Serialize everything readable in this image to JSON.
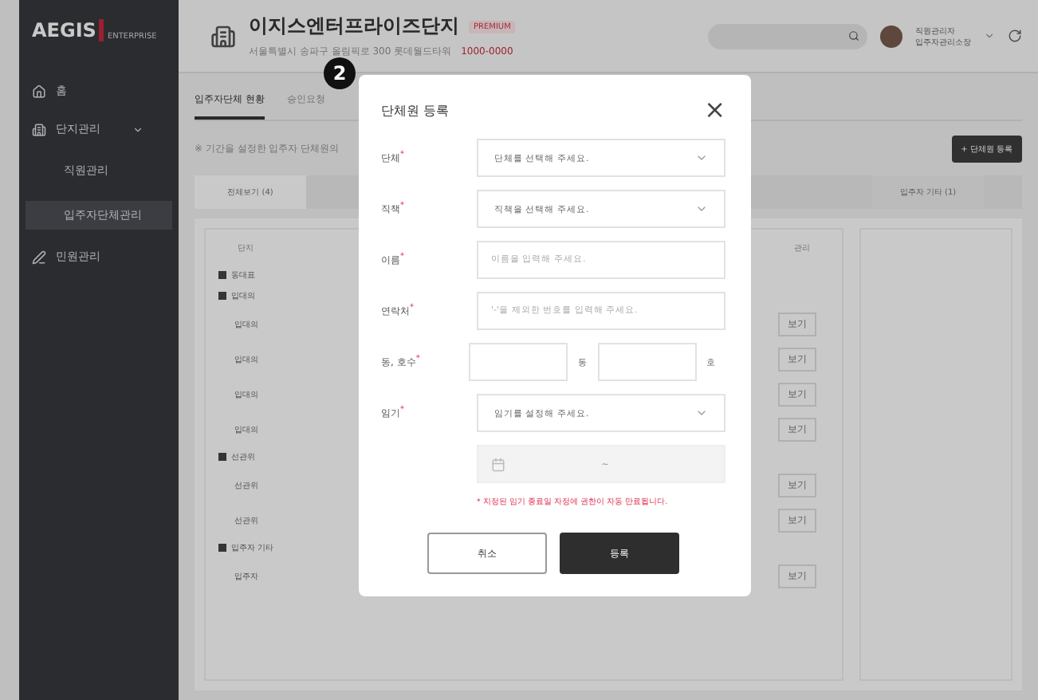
{
  "sidebar": {
    "logo": "AEGIS",
    "logo_sub": "ENTERPRISE",
    "items": [
      {
        "label": "홈",
        "selected": false
      },
      {
        "label": "단지관리",
        "selected": false,
        "expanded": true,
        "children": [
          {
            "label": "직원관리",
            "selected": false
          },
          {
            "label": "입주자단체관리",
            "selected": true
          }
        ]
      },
      {
        "label": "민원관리",
        "selected": false
      }
    ]
  },
  "header": {
    "title": "이지스엔터프라이즈단지",
    "badge": "PREMIUM",
    "address": "서울특별시 송파구 올림픽로 300 롯데월드타워",
    "phone": "1000-0000",
    "user_role": "직원관리자",
    "user_name": "입주자관리소장"
  },
  "page_tabs": [
    {
      "label": "입주자단체 현황",
      "selected": true
    },
    {
      "label": "승인요청",
      "selected": false
    }
  ],
  "notice": "※ 기간을 설정한 입주자 단체원의",
  "add_button": "+ 단체원 등록",
  "group_tabs": [
    {
      "label": "전체보기 (4)",
      "selected": true
    },
    {
      "label": "입주자 기타 (1)",
      "selected": false
    }
  ],
  "table": {
    "columns": [
      "단지",
      "관리"
    ],
    "rows": [
      {
        "kind": "group",
        "name": "동대표"
      },
      {
        "kind": "group",
        "name": "입대의"
      },
      {
        "kind": "member",
        "name": "입대의",
        "action": "보기"
      },
      {
        "kind": "member",
        "name": "입대의",
        "action": "보기"
      },
      {
        "kind": "member",
        "name": "입대의",
        "action": "보기"
      },
      {
        "kind": "member",
        "name": "입대의",
        "action": "보기"
      },
      {
        "kind": "group",
        "name": "선관위"
      },
      {
        "kind": "member",
        "name": "선관위",
        "action": "보기"
      },
      {
        "kind": "member",
        "name": "선관위",
        "action": "보기"
      },
      {
        "kind": "group",
        "name": "입주자 기타"
      },
      {
        "kind": "member",
        "name": "입주자",
        "action": "보기"
      }
    ]
  },
  "step": "2",
  "modal": {
    "title": "단체원 등록",
    "close": "×",
    "fields": [
      {
        "kind": "select",
        "label": "단체$^{*}$",
        "placeholder": "단체를 선택해 주세요."
      },
      {
        "kind": "select",
        "label": "직책$^{*}$",
        "placeholder": "직책을 선택해 주세요."
      },
      {
        "kind": "input",
        "label": "이름$^{*}$",
        "placeholder": "이름을 입력해 주세요."
      },
      {
        "kind": "input",
        "label": "연락처$^{*}$",
        "placeholder": "'-'을 제외한 번호를 입력해 주세요."
      },
      {
        "kind": "unit",
        "label": "동, 호수$^{*}$",
        "unit_1": "동",
        "unit_2": "호"
      },
      {
        "kind": "select",
        "label": "임기$^{*}$",
        "placeholder": "임기를 설정해 주세요."
      }
    ],
    "date_range": {
      "separator": "~",
      "disabled": true
    },
    "note": "* 지정된 임기 종료일 자정에 권한이 자동 만료됩니다.",
    "buttons": [
      {
        "label": "취소",
        "kind": "secondary"
      },
      {
        "label": "등록",
        "kind": "primary"
      }
    ]
  }
}
